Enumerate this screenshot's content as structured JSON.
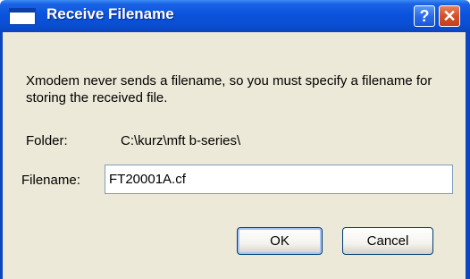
{
  "window": {
    "title": "Receive Filename",
    "help_label": "?",
    "close_label": "✕"
  },
  "message": "Xmodem never sends a filename, so you must specify a filename for storing the received file.",
  "folder": {
    "label": "Folder:",
    "value": "C:\\kurz\\mft b-series\\"
  },
  "filename": {
    "label": "Filename:",
    "value": "FT20001A.cf"
  },
  "buttons": {
    "ok": "OK",
    "cancel": "Cancel"
  },
  "colors": {
    "titlebar": "#0a53dd",
    "dialog_face": "#ece9d8",
    "close_button": "#d4502a"
  },
  "icons": [
    "window-icon",
    "help-icon",
    "close-icon"
  ]
}
